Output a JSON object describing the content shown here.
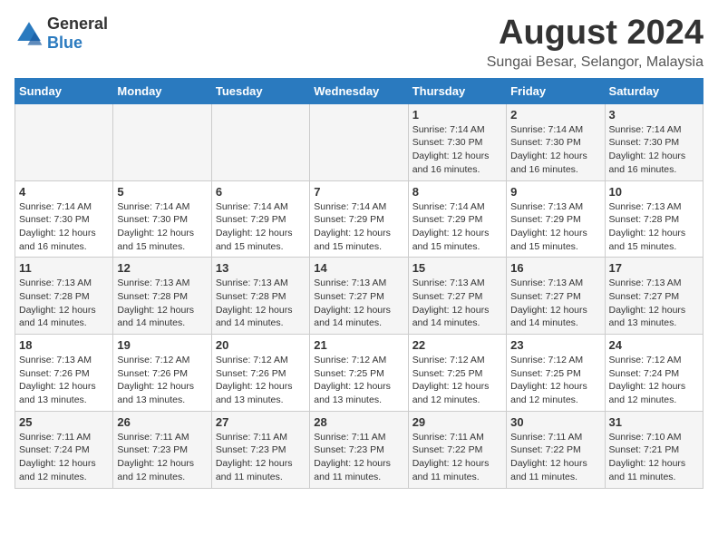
{
  "header": {
    "logo_general": "General",
    "logo_blue": "Blue",
    "main_title": "August 2024",
    "subtitle": "Sungai Besar, Selangor, Malaysia"
  },
  "calendar": {
    "days_of_week": [
      "Sunday",
      "Monday",
      "Tuesday",
      "Wednesday",
      "Thursday",
      "Friday",
      "Saturday"
    ],
    "weeks": [
      [
        {
          "day": "",
          "info": ""
        },
        {
          "day": "",
          "info": ""
        },
        {
          "day": "",
          "info": ""
        },
        {
          "day": "",
          "info": ""
        },
        {
          "day": "1",
          "info": "Sunrise: 7:14 AM\nSunset: 7:30 PM\nDaylight: 12 hours\nand 16 minutes."
        },
        {
          "day": "2",
          "info": "Sunrise: 7:14 AM\nSunset: 7:30 PM\nDaylight: 12 hours\nand 16 minutes."
        },
        {
          "day": "3",
          "info": "Sunrise: 7:14 AM\nSunset: 7:30 PM\nDaylight: 12 hours\nand 16 minutes."
        }
      ],
      [
        {
          "day": "4",
          "info": "Sunrise: 7:14 AM\nSunset: 7:30 PM\nDaylight: 12 hours\nand 16 minutes."
        },
        {
          "day": "5",
          "info": "Sunrise: 7:14 AM\nSunset: 7:30 PM\nDaylight: 12 hours\nand 15 minutes."
        },
        {
          "day": "6",
          "info": "Sunrise: 7:14 AM\nSunset: 7:29 PM\nDaylight: 12 hours\nand 15 minutes."
        },
        {
          "day": "7",
          "info": "Sunrise: 7:14 AM\nSunset: 7:29 PM\nDaylight: 12 hours\nand 15 minutes."
        },
        {
          "day": "8",
          "info": "Sunrise: 7:14 AM\nSunset: 7:29 PM\nDaylight: 12 hours\nand 15 minutes."
        },
        {
          "day": "9",
          "info": "Sunrise: 7:13 AM\nSunset: 7:29 PM\nDaylight: 12 hours\nand 15 minutes."
        },
        {
          "day": "10",
          "info": "Sunrise: 7:13 AM\nSunset: 7:28 PM\nDaylight: 12 hours\nand 15 minutes."
        }
      ],
      [
        {
          "day": "11",
          "info": "Sunrise: 7:13 AM\nSunset: 7:28 PM\nDaylight: 12 hours\nand 14 minutes."
        },
        {
          "day": "12",
          "info": "Sunrise: 7:13 AM\nSunset: 7:28 PM\nDaylight: 12 hours\nand 14 minutes."
        },
        {
          "day": "13",
          "info": "Sunrise: 7:13 AM\nSunset: 7:28 PM\nDaylight: 12 hours\nand 14 minutes."
        },
        {
          "day": "14",
          "info": "Sunrise: 7:13 AM\nSunset: 7:27 PM\nDaylight: 12 hours\nand 14 minutes."
        },
        {
          "day": "15",
          "info": "Sunrise: 7:13 AM\nSunset: 7:27 PM\nDaylight: 12 hours\nand 14 minutes."
        },
        {
          "day": "16",
          "info": "Sunrise: 7:13 AM\nSunset: 7:27 PM\nDaylight: 12 hours\nand 14 minutes."
        },
        {
          "day": "17",
          "info": "Sunrise: 7:13 AM\nSunset: 7:27 PM\nDaylight: 12 hours\nand 13 minutes."
        }
      ],
      [
        {
          "day": "18",
          "info": "Sunrise: 7:13 AM\nSunset: 7:26 PM\nDaylight: 12 hours\nand 13 minutes."
        },
        {
          "day": "19",
          "info": "Sunrise: 7:12 AM\nSunset: 7:26 PM\nDaylight: 12 hours\nand 13 minutes."
        },
        {
          "day": "20",
          "info": "Sunrise: 7:12 AM\nSunset: 7:26 PM\nDaylight: 12 hours\nand 13 minutes."
        },
        {
          "day": "21",
          "info": "Sunrise: 7:12 AM\nSunset: 7:25 PM\nDaylight: 12 hours\nand 13 minutes."
        },
        {
          "day": "22",
          "info": "Sunrise: 7:12 AM\nSunset: 7:25 PM\nDaylight: 12 hours\nand 12 minutes."
        },
        {
          "day": "23",
          "info": "Sunrise: 7:12 AM\nSunset: 7:25 PM\nDaylight: 12 hours\nand 12 minutes."
        },
        {
          "day": "24",
          "info": "Sunrise: 7:12 AM\nSunset: 7:24 PM\nDaylight: 12 hours\nand 12 minutes."
        }
      ],
      [
        {
          "day": "25",
          "info": "Sunrise: 7:11 AM\nSunset: 7:24 PM\nDaylight: 12 hours\nand 12 minutes."
        },
        {
          "day": "26",
          "info": "Sunrise: 7:11 AM\nSunset: 7:23 PM\nDaylight: 12 hours\nand 12 minutes."
        },
        {
          "day": "27",
          "info": "Sunrise: 7:11 AM\nSunset: 7:23 PM\nDaylight: 12 hours\nand 11 minutes."
        },
        {
          "day": "28",
          "info": "Sunrise: 7:11 AM\nSunset: 7:23 PM\nDaylight: 12 hours\nand 11 minutes."
        },
        {
          "day": "29",
          "info": "Sunrise: 7:11 AM\nSunset: 7:22 PM\nDaylight: 12 hours\nand 11 minutes."
        },
        {
          "day": "30",
          "info": "Sunrise: 7:11 AM\nSunset: 7:22 PM\nDaylight: 12 hours\nand 11 minutes."
        },
        {
          "day": "31",
          "info": "Sunrise: 7:10 AM\nSunset: 7:21 PM\nDaylight: 12 hours\nand 11 minutes."
        }
      ]
    ]
  }
}
